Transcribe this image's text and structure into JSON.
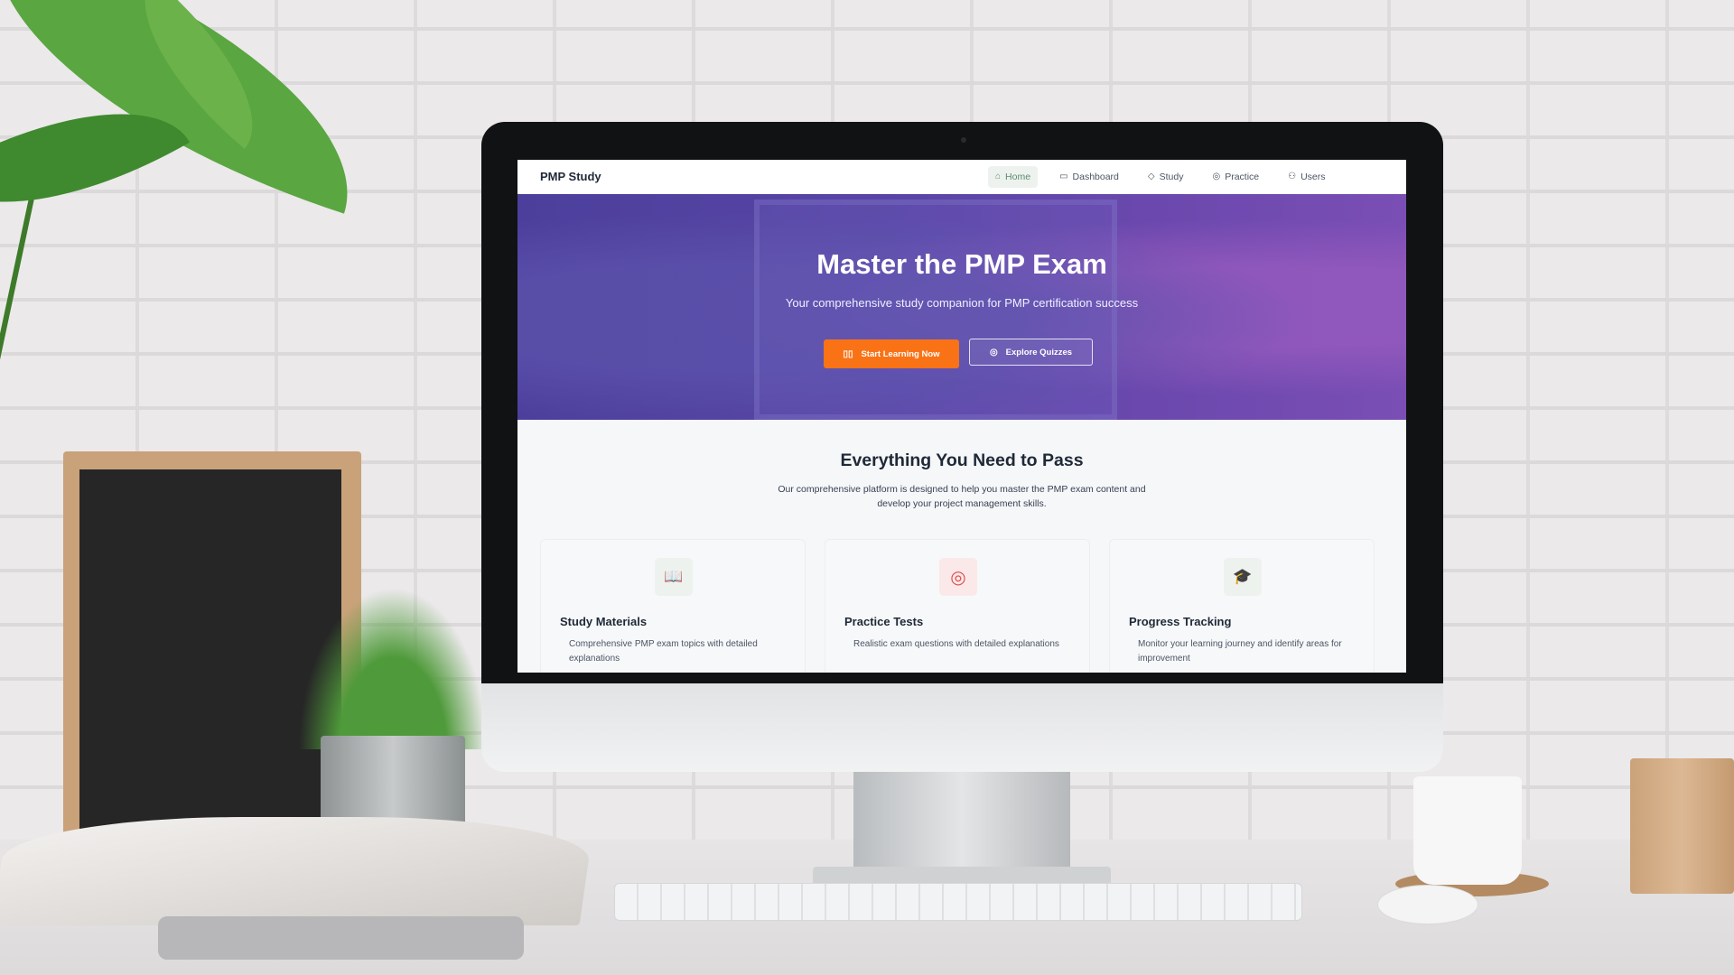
{
  "nav": {
    "brand": "PMP Study",
    "items": [
      {
        "label": "Home",
        "icon": "home-icon",
        "glyph": "⌂",
        "active": true
      },
      {
        "label": "Dashboard",
        "icon": "book-icon",
        "glyph": "▭",
        "active": false
      },
      {
        "label": "Study",
        "icon": "graduation-cap-icon",
        "glyph": "◇",
        "active": false
      },
      {
        "label": "Practice",
        "icon": "target-icon",
        "glyph": "◎",
        "active": false
      },
      {
        "label": "Users",
        "icon": "users-icon",
        "glyph": "⚇",
        "active": false
      }
    ],
    "active_color": "#5b8c6e"
  },
  "hero": {
    "title": "Master the PMP Exam",
    "subtitle": "Your comprehensive study companion for PMP certification success",
    "primary_button": {
      "label": "Start Learning Now",
      "icon": "book-open-icon"
    },
    "secondary_button": {
      "label": "Explore Quizzes",
      "icon": "target-icon"
    },
    "gradient_colors": [
      "#4c3f9c",
      "#7a4eb5"
    ]
  },
  "features": {
    "title": "Everything You Need to Pass",
    "description": "Our comprehensive platform is designed to help you master the PMP exam content and develop your project management skills.",
    "cards": [
      {
        "title": "Study Materials",
        "description": "Comprehensive PMP exam topics with detailed explanations",
        "icon": "book-open-icon",
        "glyph": "📖",
        "color": "#5b8c6e",
        "bg": "#eef2ef"
      },
      {
        "title": "Practice Tests",
        "description": "Realistic exam questions with detailed explanations",
        "icon": "target-icon",
        "glyph": "◎",
        "color": "#e24b4b",
        "bg": "#fbe9e9"
      },
      {
        "title": "Progress Tracking",
        "description": "Monitor your learning journey and identify areas for improvement",
        "icon": "graduation-cap-icon",
        "glyph": "🎓",
        "color": "#5b8c6e",
        "bg": "#eef2ef"
      }
    ]
  },
  "colors": {
    "accent_orange": "#f97316",
    "text_dark": "#1f2937"
  }
}
